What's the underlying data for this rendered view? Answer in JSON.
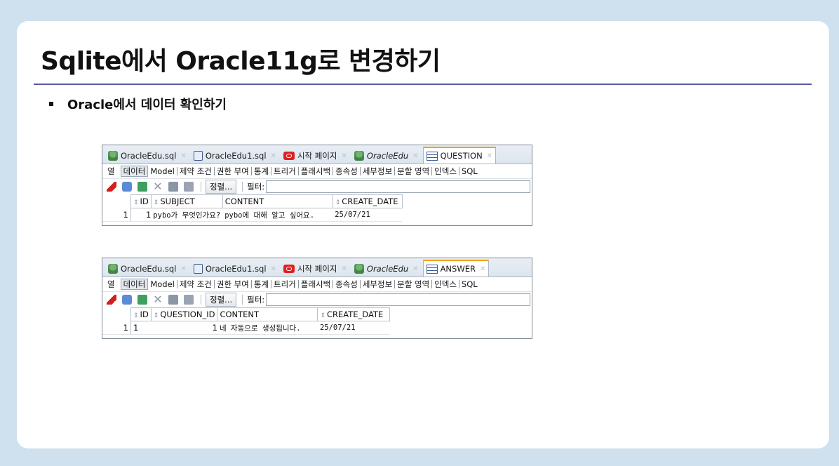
{
  "slide": {
    "title": "Sqlite에서 Oracle11g로 변경하기",
    "bullet": "Oracle에서 데이터 확인하기"
  },
  "panels": [
    {
      "tabs": [
        {
          "label": "OracleEdu.sql",
          "icon": "db-icon"
        },
        {
          "label": "OracleEdu1.sql",
          "icon": "sql-file-icon"
        },
        {
          "label": "시작 페이지",
          "icon": "oracle-icon"
        },
        {
          "label": "OracleEdu",
          "icon": "db-icon"
        },
        {
          "label": "QUESTION",
          "icon": "table-icon"
        }
      ],
      "menu": [
        "열",
        "데이터",
        "Model",
        "제약 조건",
        "권한 부여",
        "통계",
        "트리거",
        "플래시백",
        "종속성",
        "세부정보",
        "분할 영역",
        "인덱스",
        "SQL"
      ],
      "sort_label": "정렬...",
      "filter_label": "필터:",
      "columns": [
        "ID",
        "SUBJECT",
        "CONTENT",
        "CREATE_DATE"
      ],
      "rows": [
        {
          "rownum": "1",
          "id": "1",
          "subject": "pybo가 무엇인가요?",
          "content": "pybo에 대해 알고 싶어요.",
          "create_date": "25/07/21"
        }
      ]
    },
    {
      "tabs": [
        {
          "label": "OracleEdu.sql",
          "icon": "db-icon"
        },
        {
          "label": "OracleEdu1.sql",
          "icon": "sql-file-icon"
        },
        {
          "label": "시작 페이지",
          "icon": "oracle-icon"
        },
        {
          "label": "OracleEdu",
          "icon": "db-icon"
        },
        {
          "label": "ANSWER",
          "icon": "table-icon"
        }
      ],
      "menu": [
        "열",
        "데이터",
        "Model",
        "제약 조건",
        "권한 부여",
        "통계",
        "트리거",
        "플래시백",
        "종속성",
        "세부정보",
        "분할 영역",
        "인덱스",
        "SQL"
      ],
      "sort_label": "정렬...",
      "filter_label": "필터:",
      "columns": [
        "ID",
        "QUESTION_ID",
        "CONTENT",
        "CREATE_DATE"
      ],
      "rows": [
        {
          "rownum": "1",
          "id": "1",
          "question_id": "1",
          "content": "네 자동으로 생성됩니다.",
          "create_date": "25/07/21"
        }
      ]
    }
  ]
}
